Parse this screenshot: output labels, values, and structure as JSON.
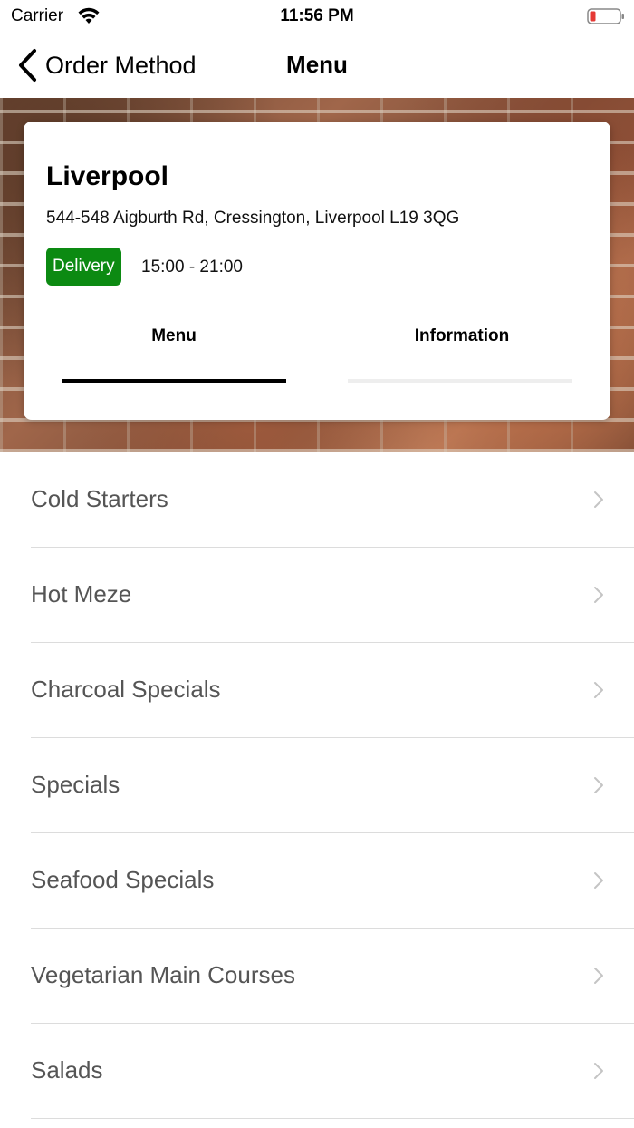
{
  "status_bar": {
    "carrier": "Carrier",
    "time": "11:56 PM",
    "wifi_icon": "wifi-icon",
    "battery_icon": "battery-low-icon",
    "battery_color": "#e53935"
  },
  "nav": {
    "back_label": "Order Method",
    "back_icon": "chevron-left-icon",
    "title": "Menu"
  },
  "store": {
    "name": "Liverpool",
    "address": "544-548 Aigburth Rd, Cressington, Liverpool L19 3QG",
    "badge": "Delivery",
    "badge_color": "#0c8a12",
    "hours": "15:00 - 21:00"
  },
  "tabs": [
    {
      "label": "Menu",
      "selected": true
    },
    {
      "label": "Information",
      "selected": false
    }
  ],
  "menu_categories": [
    {
      "label": "Cold Starters"
    },
    {
      "label": "Hot Meze"
    },
    {
      "label": "Charcoal Specials"
    },
    {
      "label": "Specials"
    },
    {
      "label": "Seafood Specials"
    },
    {
      "label": "Vegetarian Main Courses"
    },
    {
      "label": "Salads"
    }
  ]
}
